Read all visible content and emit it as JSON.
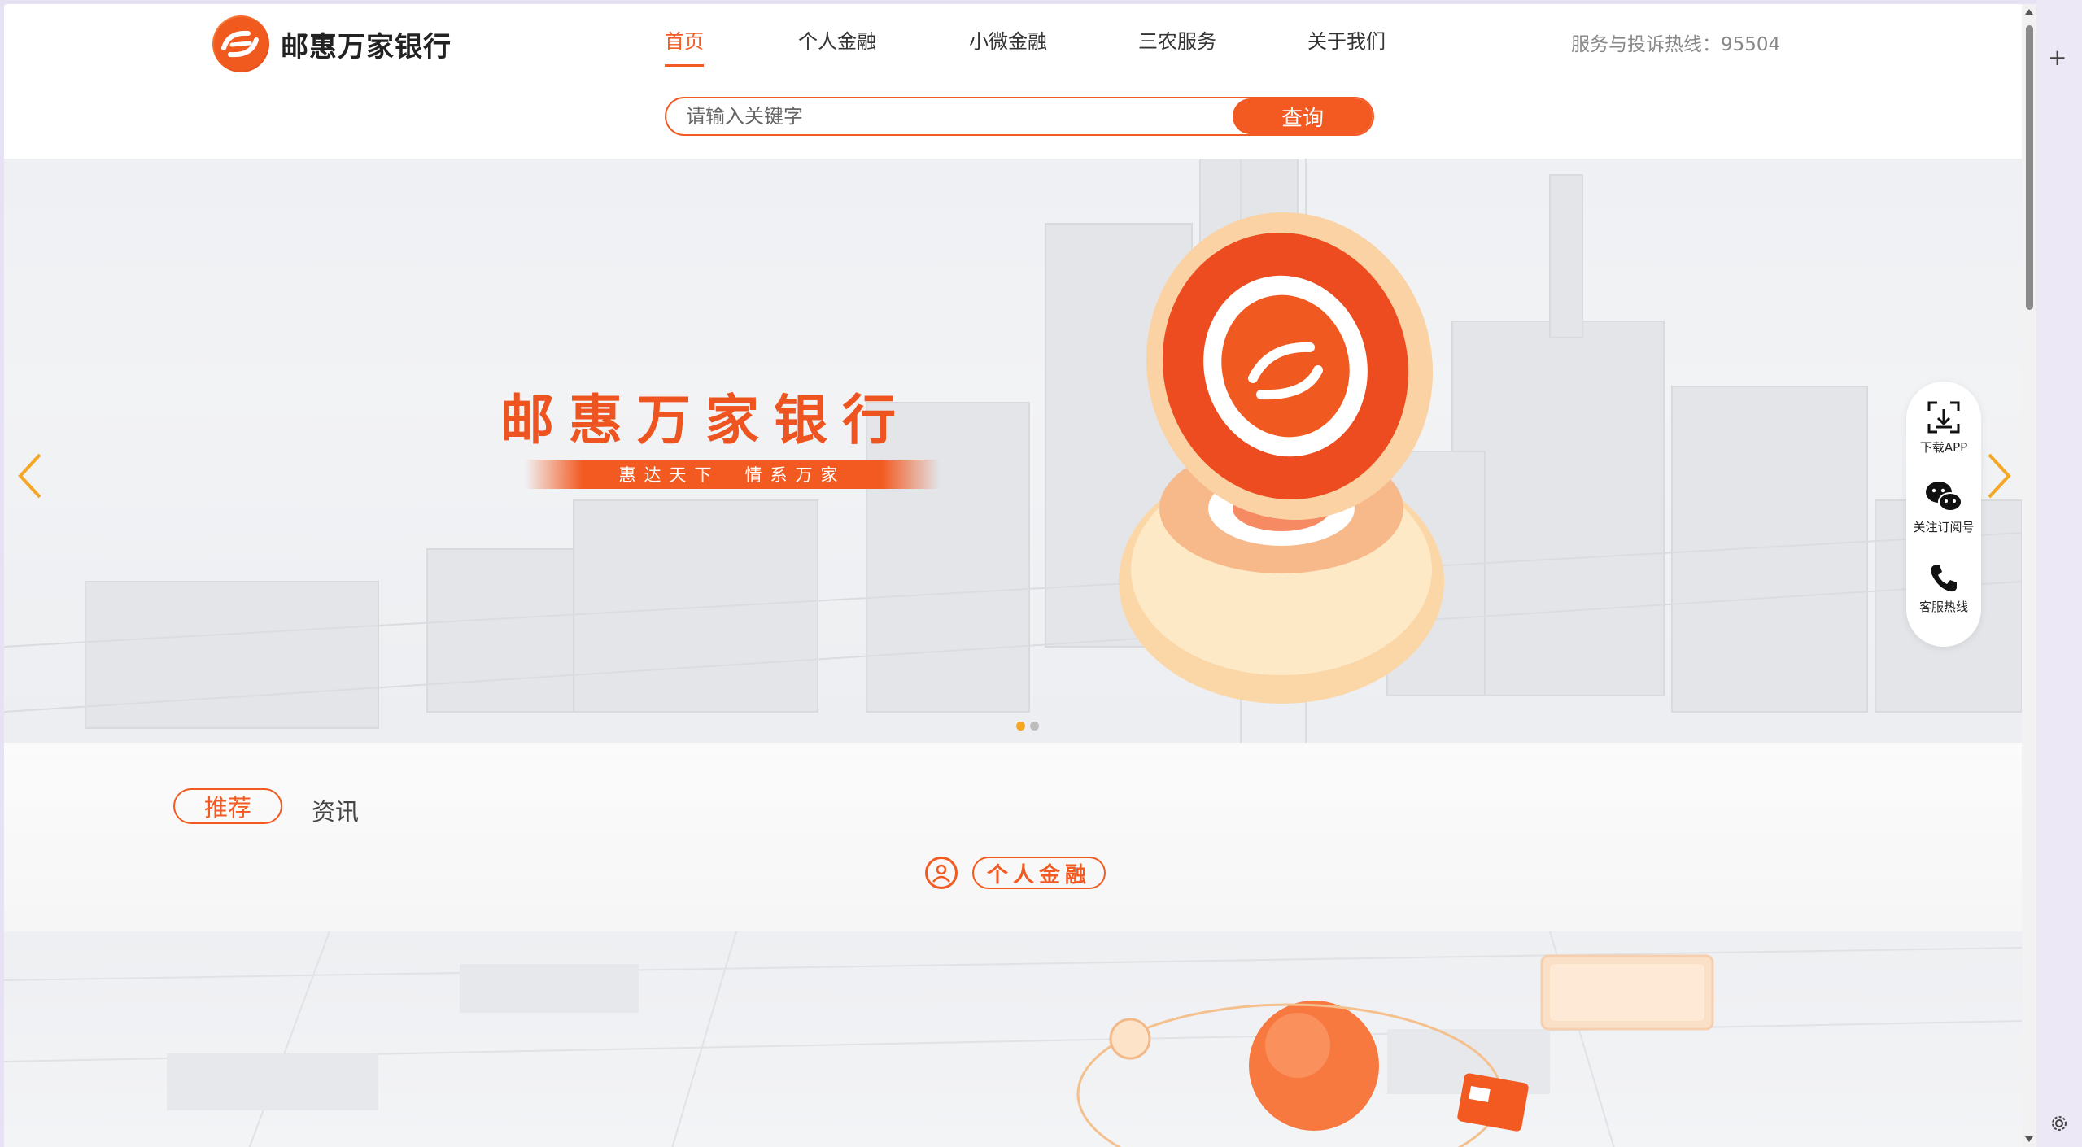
{
  "brand": {
    "logo_mark": "GS",
    "name": "邮惠万家银行"
  },
  "nav": {
    "items": [
      {
        "label": "首页",
        "active": true
      },
      {
        "label": "个人金融",
        "active": false
      },
      {
        "label": "小微金融",
        "active": false
      },
      {
        "label": "三农服务",
        "active": false
      },
      {
        "label": "关于我们",
        "active": false
      }
    ],
    "hotline": "服务与投诉热线：95504"
  },
  "search": {
    "placeholder": "请输入关键字",
    "button_label": "查询"
  },
  "banner": {
    "title": "邮惠万家银行",
    "slogan": "惠达天下　情系万家",
    "slide_count": 2,
    "active_slide": 1
  },
  "float_bar": {
    "items": [
      {
        "icon": "qrcode-download-icon",
        "label": "下载APP"
      },
      {
        "icon": "wechat-icon",
        "label": "关注订阅号"
      },
      {
        "icon": "phone-icon",
        "label": "客服热线"
      }
    ]
  },
  "tabs": {
    "items": [
      {
        "label": "推荐",
        "active": true
      },
      {
        "label": "资讯",
        "active": false
      }
    ]
  },
  "section": {
    "heading_icon": "user-circle-icon",
    "heading": "个人金融"
  },
  "colors": {
    "accent": "#f25a21",
    "text": "#333333",
    "muted": "#888888"
  }
}
